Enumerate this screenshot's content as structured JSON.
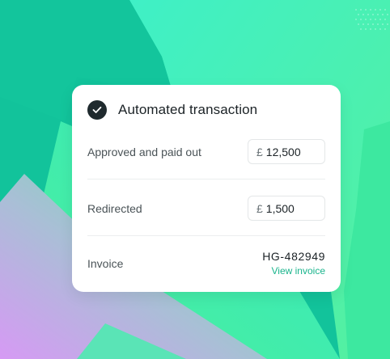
{
  "colors": {
    "accent": "#19b48c",
    "background_teal": "#12c39b",
    "background_green": "#4cf09b",
    "background_purple": "#d69af4",
    "check_badge": "#1f2a2e"
  },
  "card": {
    "header": {
      "icon": "check-circle-icon",
      "title": "Automated transaction"
    },
    "rows": [
      {
        "label": "Approved and paid out",
        "currency": "£",
        "amount": "12,500"
      },
      {
        "label": "Redirected",
        "currency": "£",
        "amount": "1,500"
      }
    ],
    "invoice": {
      "label": "Invoice",
      "id": "HG-482949",
      "link": "View invoice"
    }
  }
}
